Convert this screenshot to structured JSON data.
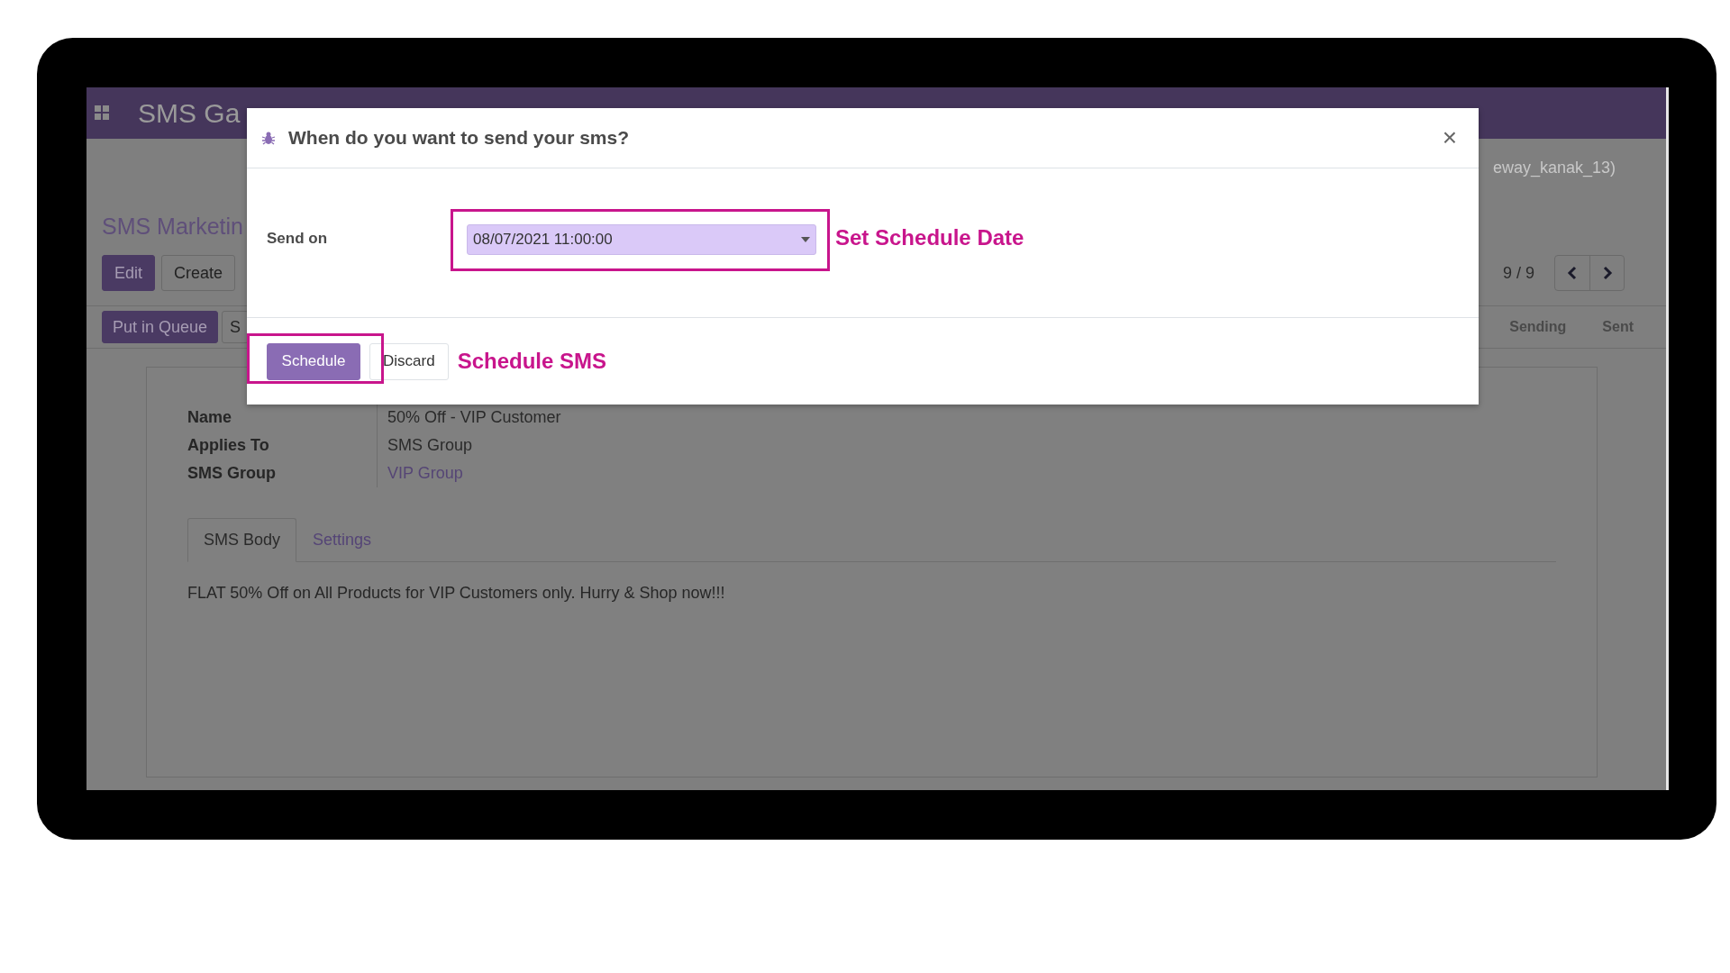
{
  "app": {
    "title": "SMS Ga",
    "user_menu": "eway_kanak_13)"
  },
  "control_panel": {
    "breadcrumb": "SMS Marketin",
    "buttons": [
      {
        "label": "Edit",
        "kind": "primary"
      },
      {
        "label": "Create",
        "kind": "secondary"
      }
    ],
    "pager": "9 / 9"
  },
  "statusbar": {
    "buttons": [
      {
        "label": "Put in Queue",
        "kind": "primary"
      },
      {
        "label": "S",
        "kind": "secondary"
      }
    ],
    "stages": [
      "Sending",
      "Sent"
    ]
  },
  "sheet": {
    "fields": [
      {
        "label": "Name",
        "value": "50% Off - VIP Customer",
        "kind": "text"
      },
      {
        "label": "Applies To",
        "value": "SMS Group",
        "kind": "text"
      },
      {
        "label": "SMS Group",
        "value": "VIP Group",
        "kind": "link"
      }
    ],
    "tabs": [
      {
        "label": "SMS Body",
        "selected": true
      },
      {
        "label": "Settings",
        "selected": false
      }
    ],
    "body": "FLAT 50% Off on All Products for VIP Customers only. Hurry & Shop now!!!"
  },
  "dialog": {
    "title": "When do you want to send your sms?",
    "close": "×",
    "field": {
      "label": "Send on",
      "value": "08/07/2021 11:00:00"
    },
    "buttons": [
      {
        "label": "Schedule",
        "kind": "primary"
      },
      {
        "label": "Discard",
        "kind": "secondary"
      }
    ]
  },
  "annotations": [
    "Set Schedule Date",
    "Schedule SMS"
  ]
}
